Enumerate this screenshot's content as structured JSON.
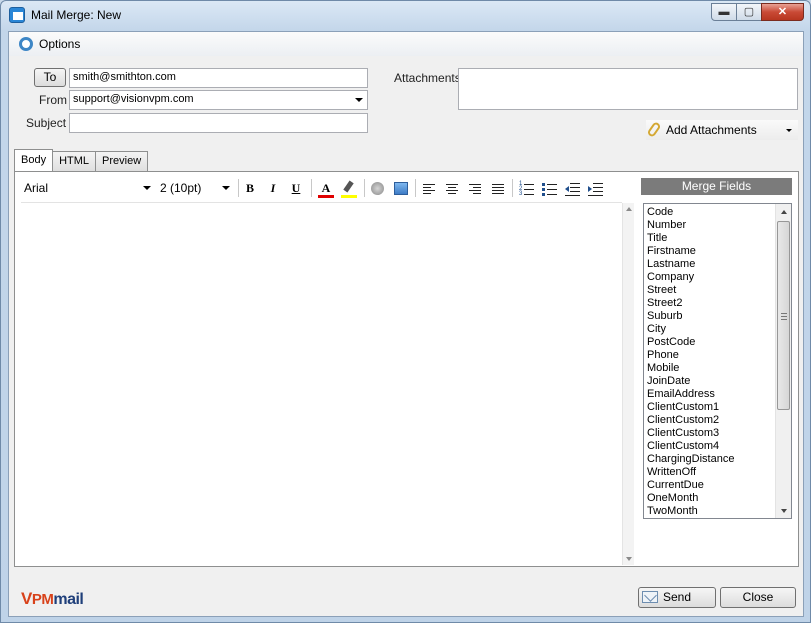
{
  "window": {
    "title": "Mail Merge: New",
    "controls": {
      "minimize": "▬",
      "maximize": "▢",
      "close": "✕"
    }
  },
  "options": {
    "label": "Options",
    "icon": "gear-icon"
  },
  "form": {
    "to_button": "To",
    "to_value": "smith@smithton.com",
    "from_label": "From",
    "from_value": "support@visionvpm.com",
    "subject_label": "Subject",
    "subject_value": "",
    "attachments_label": "Attachments",
    "add_attachments_label": "Add Attachments"
  },
  "tabs": [
    {
      "label": "Body",
      "active": true
    },
    {
      "label": "HTML",
      "active": false
    },
    {
      "label": "Preview",
      "active": false
    }
  ],
  "toolbar": {
    "font": "Arial",
    "size": "2 (10pt)",
    "bold": "B",
    "italic": "I",
    "underline": "U",
    "font_color_glyph": "A",
    "font_color": "#e00000",
    "highlight_color": "#ffff00"
  },
  "merge_fields": {
    "header": "Merge Fields",
    "items": [
      "Code",
      "Number",
      "Title",
      "Firstname",
      "Lastname",
      "Company",
      "Street",
      "Street2",
      "Suburb",
      "City",
      "PostCode",
      "Phone",
      "Mobile",
      "JoinDate",
      "EmailAddress",
      "ClientCustom1",
      "ClientCustom2",
      "ClientCustom3",
      "ClientCustom4",
      "ChargingDistance",
      "WrittenOff",
      "CurrentDue",
      "OneMonth",
      "TwoMonth"
    ]
  },
  "footer": {
    "logo_v": "V",
    "logo_pm": "PM",
    "logo_mail": "mail",
    "send_label": "Send",
    "close_label": "Close"
  }
}
